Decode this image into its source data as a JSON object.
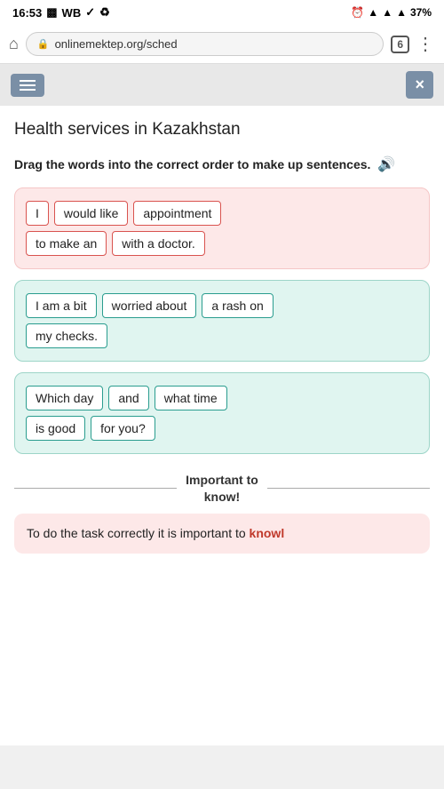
{
  "statusBar": {
    "time": "16:53",
    "icons": [
      "sim",
      "wb",
      "check",
      "share"
    ],
    "battery": "37%"
  },
  "browserBar": {
    "url": "onlinemektep.org/sched",
    "tabCount": "6"
  },
  "toolbar": {
    "hamburger_label": "menu",
    "close_label": "×"
  },
  "pageTitle": "Health services in Kazakhstan",
  "instructions": "Drag the words into the correct order to make up sentences.",
  "audioLabel": "🔊",
  "sentences": [
    {
      "type": "pink",
      "rows": [
        [
          "I",
          "would like",
          "appointment"
        ],
        [
          "to make an",
          "with a doctor."
        ]
      ]
    },
    {
      "type": "teal",
      "rows": [
        [
          "I am a bit",
          "worried about",
          "a rash on"
        ],
        [
          "my checks."
        ]
      ]
    },
    {
      "type": "teal",
      "rows": [
        [
          "Which day",
          "and",
          "what time"
        ],
        [
          "is good",
          "for you?"
        ]
      ]
    }
  ],
  "importantSection": {
    "label": "Important to\nknow!"
  },
  "bottomCard": {
    "text": "To do the task correctly it is important to",
    "highlight": "knowl"
  }
}
